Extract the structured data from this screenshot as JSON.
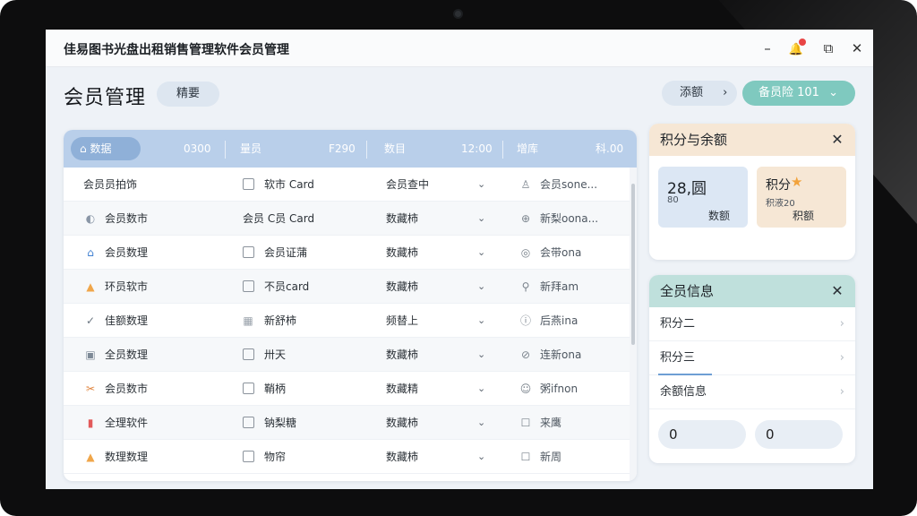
{
  "window": {
    "title": "佳易图书光盘出租销售管理软件会员管理",
    "minimize": "–",
    "notify": "🔔",
    "restore": "⧉",
    "close": "✕"
  },
  "header": {
    "title": "会员管理",
    "tag": "精要",
    "nav_label": "添额",
    "nav_arrow": "›",
    "action_label": "备员险 101",
    "action_arrow": "⌄"
  },
  "table": {
    "headers": [
      {
        "label": "数据",
        "value": "0300",
        "icon": "home-icon"
      },
      {
        "label": "量员",
        "value": "F290"
      },
      {
        "label": "数目",
        "value": "12:00"
      },
      {
        "label": "增库",
        "value": "科.00"
      }
    ],
    "rows": [
      {
        "icon": "",
        "icon_name": "none",
        "name": "会员员拍饰",
        "check": "□",
        "c2": "软市 Card",
        "c3": "会员查中",
        "c4icon": "♙",
        "c4icon_name": "user-icon",
        "c4": "会员sone..."
      },
      {
        "icon": "◐",
        "icon_name": "badge-icon",
        "name": "会员数市",
        "check": "",
        "c2": "会员 C员 Card",
        "c3": "数藏柿",
        "c4icon": "⊕",
        "c4icon_name": "add-circle-icon",
        "c4": "新梨oona..."
      },
      {
        "icon": "⌂",
        "icon_name": "home-icon",
        "name": "会员数理",
        "check": "□",
        "c2": "会员证蒲",
        "c3": "数藏柿",
        "c4icon": "◎",
        "c4icon_name": "target-icon",
        "c4": "会带ona"
      },
      {
        "icon": "▲",
        "icon_name": "person-icon",
        "name": "环员软市",
        "check": "□",
        "c2": "不员card",
        "c3": "数藏柿",
        "c4icon": "⚲",
        "c4icon_name": "link-icon",
        "c4": "新拜am"
      },
      {
        "icon": "✓",
        "icon_name": "check-circle-icon",
        "name": "佳额数理",
        "check": "▦",
        "c2": "新舒柿",
        "c3": "频替上",
        "c4icon": "ⓘ",
        "c4icon_name": "info-icon",
        "c4": "后燕ina"
      },
      {
        "icon": "▣",
        "icon_name": "document-icon",
        "name": "全员数理",
        "check": "□",
        "c2": "卅天",
        "c3": "数藏柿",
        "c4icon": "⊘",
        "c4icon_name": "sync-icon",
        "c4": "连新ona"
      },
      {
        "icon": "✂",
        "icon_name": "tools-icon",
        "name": "会员数市",
        "check": "□",
        "c2": "鞘柄",
        "c3": "数藏精",
        "c4icon": "☺",
        "c4icon_name": "face-icon",
        "c4": "粥ifnon"
      },
      {
        "icon": "▮",
        "icon_name": "chart-icon",
        "name": "全理软件",
        "check": "□",
        "c2": "钠梨糖",
        "c3": "数藏柿",
        "c4icon": "☐",
        "c4icon_name": "message-icon",
        "c4": "来鹰"
      },
      {
        "icon": "▲",
        "icon_name": "person-icon",
        "name": "数理数理",
        "check": "□",
        "c2": "物帘",
        "c3": "数藏柿",
        "c4icon": "☐",
        "c4icon_name": "note-icon",
        "c4": "新周"
      }
    ]
  },
  "points_panel": {
    "title": "积分与余额",
    "stat1": {
      "value": "28,圆",
      "sub": "80",
      "label": "数额"
    },
    "stat2": {
      "value": "积分",
      "sub": "积液20",
      "label": "积额",
      "star": "★"
    }
  },
  "info_panel": {
    "title": "全员信息",
    "items": [
      "积分二",
      "积分三",
      "余额信息"
    ],
    "input1": "0",
    "input2": "0"
  }
}
